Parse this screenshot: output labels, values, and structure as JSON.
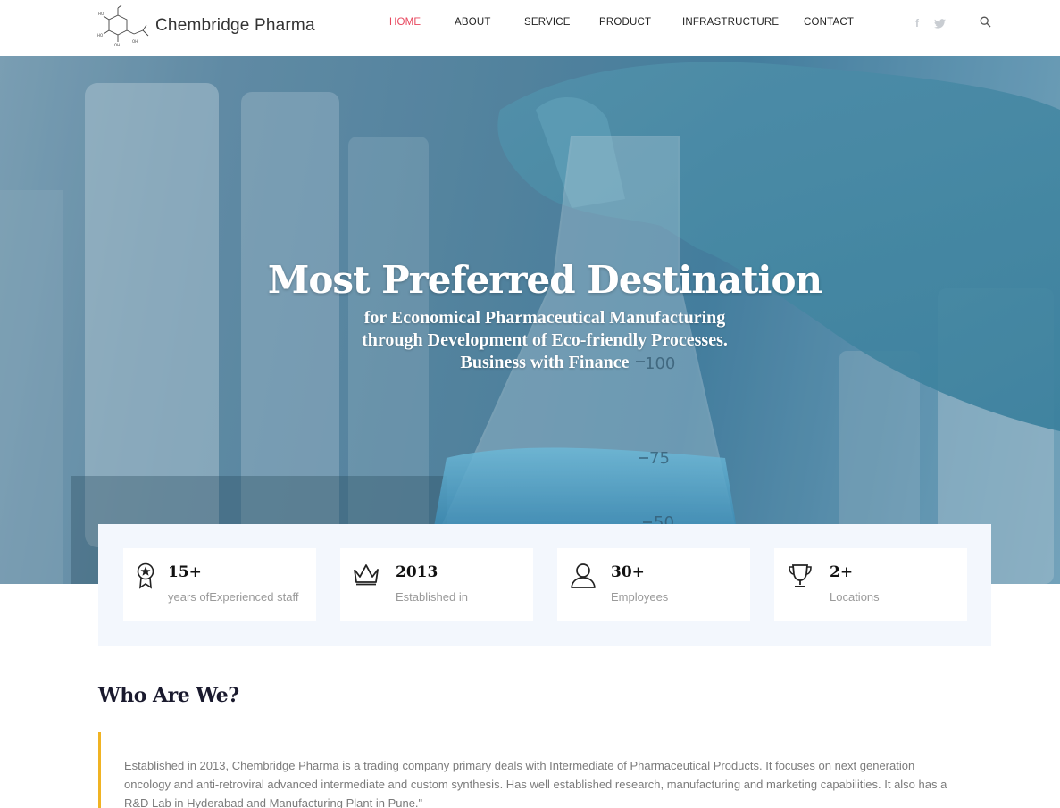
{
  "header": {
    "logo_text": "Chembridge Pharma",
    "nav": [
      {
        "label": "HOME",
        "active": true
      },
      {
        "label": "ABOUT",
        "active": false
      },
      {
        "label": "SERVICE",
        "active": false
      },
      {
        "label": "PRODUCT",
        "active": false
      },
      {
        "label": "INFRASTRUCTURE",
        "active": false
      },
      {
        "label": "CONTACT",
        "active": false
      }
    ],
    "social": {
      "facebook": "f",
      "twitter_icon": "twitter-icon"
    },
    "accent_color": "#e8485f"
  },
  "hero": {
    "title": "Most Preferred Destination",
    "lines": [
      "for Economical Pharmaceutical Manufacturing",
      "through Development of Eco-friendly Processes.",
      "Business with Finance"
    ]
  },
  "stats": [
    {
      "icon": "award-ribbon-icon",
      "value": "15+",
      "label": "years ofExperienced staff"
    },
    {
      "icon": "crown-icon",
      "value": "2013",
      "label": "Established in"
    },
    {
      "icon": "user-icon",
      "value": "30+",
      "label": "Employees"
    },
    {
      "icon": "trophy-icon",
      "value": "2+",
      "label": "Locations"
    }
  ],
  "about": {
    "title": "Who Are We?",
    "text": "Established in 2013, Chembridge Pharma is a trading company primary deals with Intermediate of Pharmaceutical Products. It focuses on next generation oncology and anti-retroviral advanced intermediate and custom synthesis. Has well established research, manufacturing and marketing capabilities. It also has a R&D Lab in Hyderabad and Manufacturing Plant in Pune.\"",
    "bar_color": "#f0b323"
  }
}
